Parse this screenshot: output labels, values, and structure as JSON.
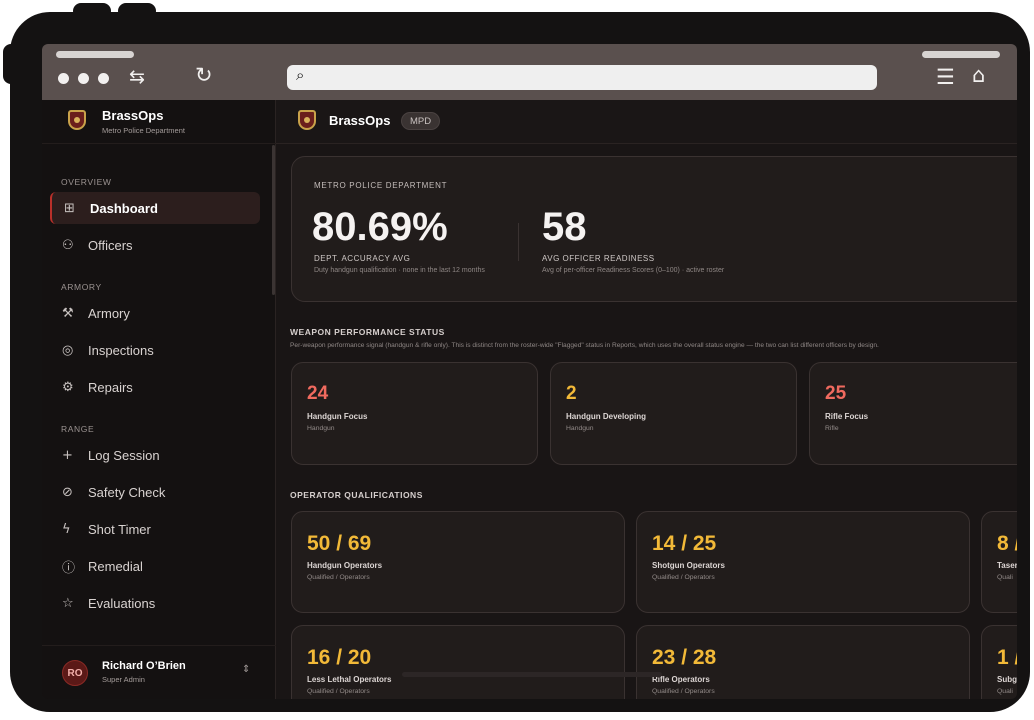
{
  "brand": {
    "name": "BrassOps",
    "department": "Metro Police Department",
    "badge": "MPD"
  },
  "sidebar": {
    "sections": [
      {
        "label": "OVERVIEW",
        "items": [
          {
            "label": "Dashboard",
            "icon": "grid-icon",
            "active": true
          },
          {
            "label": "Officers",
            "icon": "users-icon"
          }
        ]
      },
      {
        "label": "ARMORY",
        "items": [
          {
            "label": "Armory",
            "icon": "wrench-icon"
          },
          {
            "label": "Inspections",
            "icon": "inspect-icon"
          },
          {
            "label": "Repairs",
            "icon": "tool-icon"
          }
        ]
      },
      {
        "label": "RANGE",
        "items": [
          {
            "label": "Log Session",
            "icon": "plus-icon"
          },
          {
            "label": "Safety Check",
            "icon": "check-circle-icon"
          },
          {
            "label": "Shot Timer",
            "icon": "bolt-icon"
          },
          {
            "label": "Remedial",
            "icon": "alert-circle-icon"
          },
          {
            "label": "Evaluations",
            "icon": "star-icon"
          }
        ]
      }
    ],
    "user": {
      "initials": "RO",
      "name": "Richard O’Brien",
      "role": "Super Admin"
    }
  },
  "hero": {
    "org": "METRO POLICE DEPARTMENT",
    "metrics": [
      {
        "value": "80.69%",
        "label": "DEPT. ACCURACY AVG",
        "sub": "Duty handgun qualification · none in the last 12 months"
      },
      {
        "value": "58",
        "label": "AVG OFFICER READINESS",
        "sub": "Avg of per-officer Readiness Scores (0–100) · active roster"
      }
    ]
  },
  "weapon_status": {
    "title": "WEAPON PERFORMANCE STATUS",
    "description": "Per-weapon performance signal (handgun & rifle only). This is distinct from the roster-wide \"Flagged\" status in Reports, which uses the overall status engine — the two can list different officers by design.",
    "cards": [
      {
        "value": "24",
        "title": "Handgun Focus",
        "sub": "Handgun"
      },
      {
        "value": "2",
        "title": "Handgun Developing",
        "sub": "Handgun"
      },
      {
        "value": "25",
        "title": "Rifle Focus",
        "sub": "Rifle"
      }
    ]
  },
  "qualifications": {
    "title": "OPERATOR QUALIFICATIONS",
    "cards": [
      {
        "value": "50 / 69",
        "title": "Handgun Operators",
        "sub": "Qualified / Operators"
      },
      {
        "value": "14 / 25",
        "title": "Shotgun Operators",
        "sub": "Qualified / Operators"
      },
      {
        "value": "8 /",
        "title": "Taser",
        "sub": "Quali"
      },
      {
        "value": "16 / 20",
        "title": "Less Lethal Operators",
        "sub": "Qualified / Operators"
      },
      {
        "value": "23 / 28",
        "title": "Rifle Operators",
        "sub": "Qualified / Operators"
      },
      {
        "value": "1 /",
        "title": "Subg",
        "sub": "Quali"
      }
    ]
  },
  "colors": {
    "accent_red": "#f06a5f",
    "accent_yellow": "#f2b938",
    "active_border": "#b9302a"
  }
}
